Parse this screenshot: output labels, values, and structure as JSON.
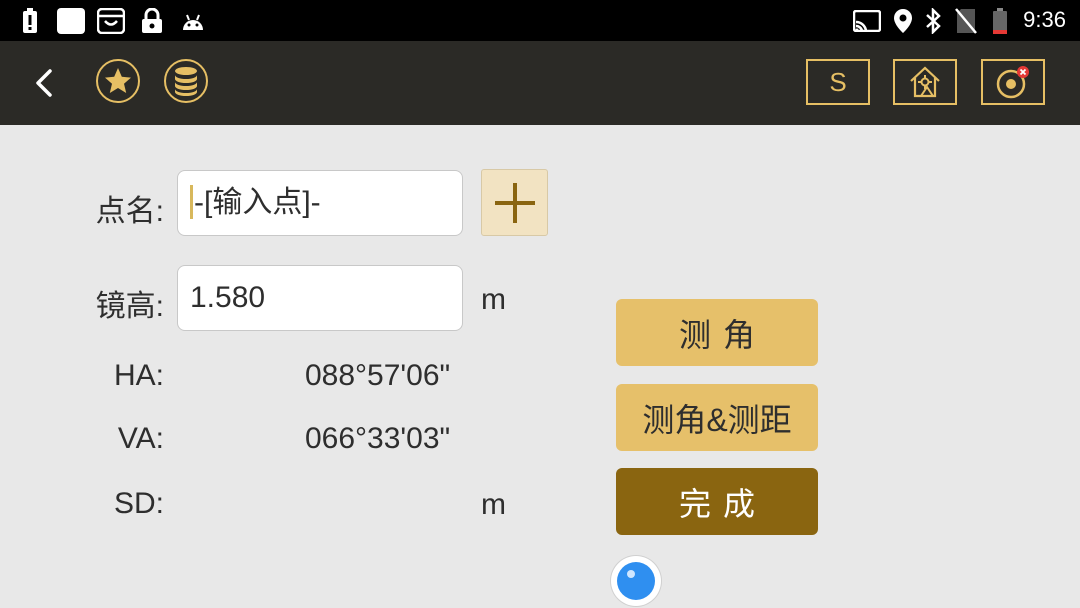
{
  "status_bar": {
    "time": "9:36",
    "icons": [
      "alert-icon",
      "app-icon",
      "bag-icon",
      "lock-icon",
      "android-icon",
      "cast-icon",
      "location-icon",
      "bluetooth-icon",
      "no-sim-icon",
      "battery-icon"
    ]
  },
  "app_bar": {
    "back_icon": "back-arrow-icon",
    "favorite_icon": "star-icon",
    "database_icon": "database-icon",
    "s_button_label": "S",
    "station_icon": "station-house-icon",
    "target_icon": "target-disconnected-icon",
    "accent_color": "#e6bf64"
  },
  "form": {
    "point_name": {
      "label": "点名:",
      "value": "-[输入点]-"
    },
    "add_icon": "plus-icon",
    "prism_height": {
      "label": "镜高:",
      "value": "1.580",
      "unit": "m"
    },
    "ha": {
      "label": "HA:",
      "value": "088°57'06\""
    },
    "va": {
      "label": "VA:",
      "value": "066°33'03\""
    },
    "sd": {
      "label": "SD:",
      "value": "",
      "unit": "m"
    }
  },
  "actions": {
    "measure_angle": "测角",
    "measure_angle_distance": "测角&测距",
    "done": "完成"
  },
  "fab_icon": "floating-action-icon"
}
